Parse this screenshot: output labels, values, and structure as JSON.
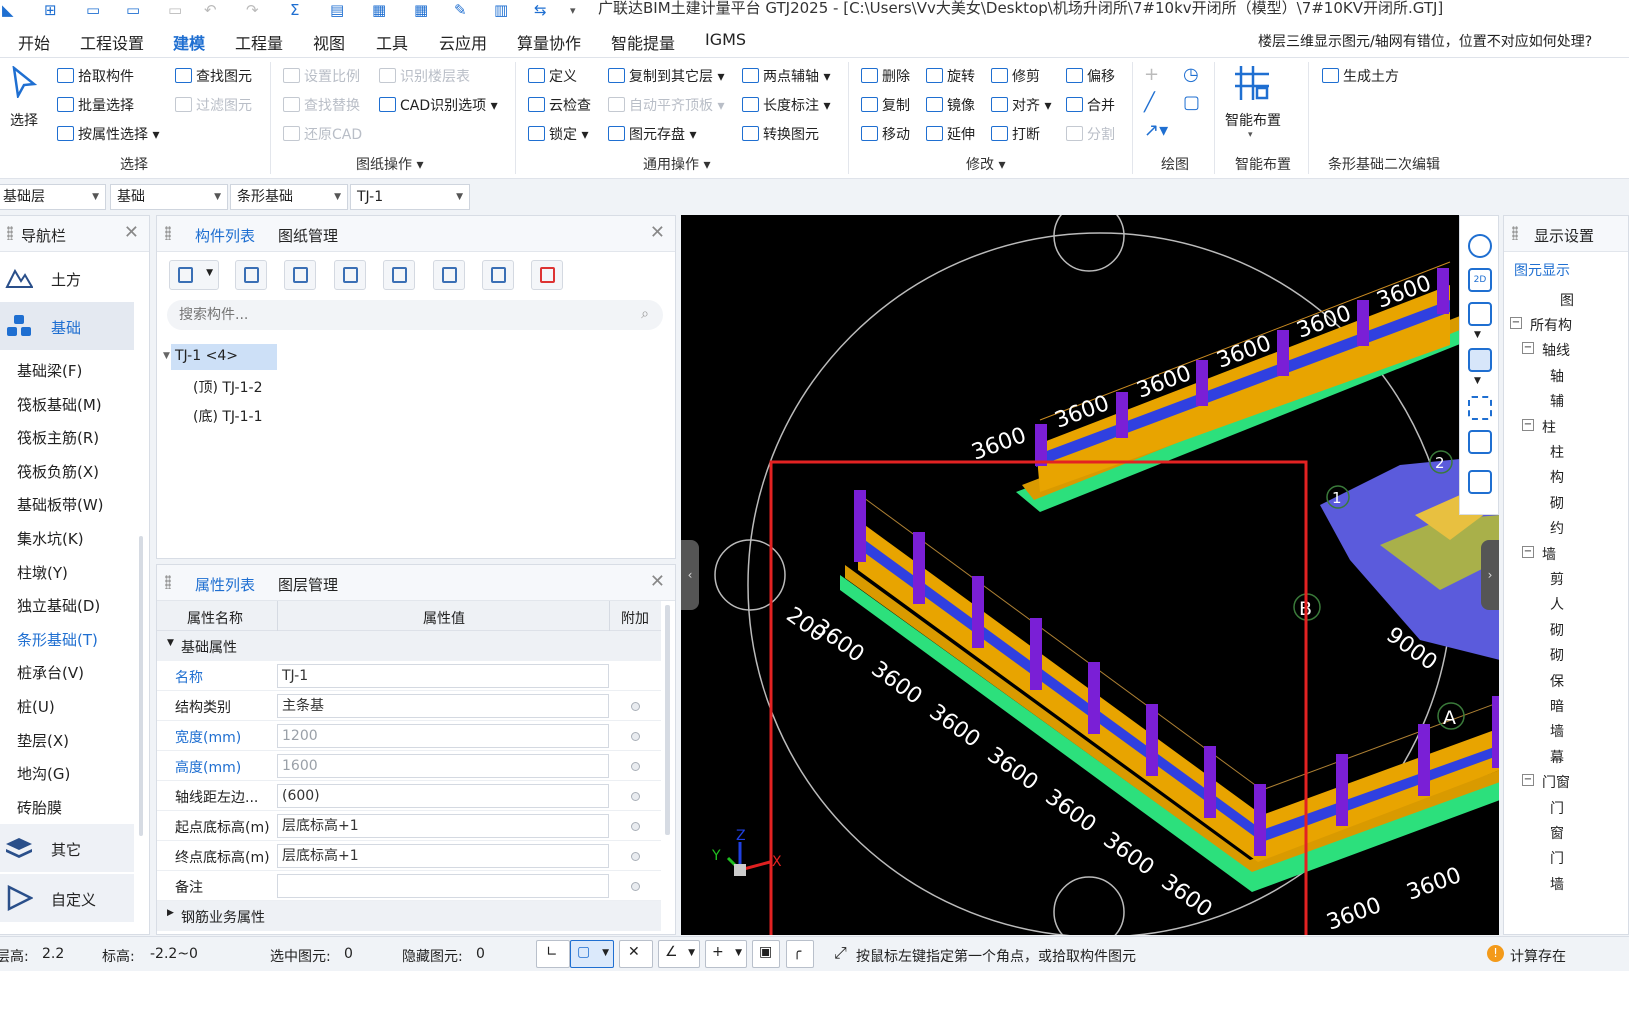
{
  "titlebar": {
    "title": "广联达BIM土建计量平台 GTJ2025 - [C:\\Users\\Vv大美女\\Desktop\\机场升闭所\\7#10kv开闭所（模型）\\7#10KV开闭所.GTJ]"
  },
  "menu": {
    "items": [
      "开始",
      "工程设置",
      "建模",
      "工程量",
      "视图",
      "工具",
      "云应用",
      "算量协作",
      "智能提量",
      "IGMS"
    ],
    "active": "建模",
    "help_question": "楼层三维显示图元/轴网有错位，位置不对应如何处理?"
  },
  "ribbon": {
    "select": {
      "label": "选择",
      "items": [
        "拾取构件",
        "批量选择",
        "按属性选择"
      ],
      "group": "选择"
    },
    "drawing_ops": {
      "items": [
        "查找图元",
        "过滤图元",
        "设置比例",
        "查找替换",
        "还原CAD",
        "识别楼层表",
        "CAD识别选项"
      ],
      "group": "图纸操作"
    },
    "common_ops": {
      "items": [
        "定义",
        "云检查",
        "锁定",
        "复制到其它层",
        "自动平齐顶板",
        "图元存盘",
        "两点辅轴",
        "长度标注",
        "转换图元"
      ],
      "group": "通用操作"
    },
    "modify": {
      "items": [
        "删除",
        "复制",
        "移动",
        "旋转",
        "镜像",
        "延伸",
        "修剪",
        "对齐",
        "打断",
        "偏移",
        "合并",
        "分割"
      ],
      "group": "修改"
    },
    "draw": {
      "group": "绘图"
    },
    "smart_layout": {
      "label": "智能布置",
      "group": "智能布置"
    },
    "strip_edit": {
      "items": [
        "生成土方"
      ],
      "group": "条形基础二次编辑"
    }
  },
  "selectors": {
    "floor": "基础层",
    "category": "基础",
    "type": "条形基础",
    "component": "TJ-1"
  },
  "nav": {
    "title": "导航栏",
    "groups": [
      {
        "label": "土方"
      },
      {
        "label": "基础"
      },
      {
        "label": "其它"
      },
      {
        "label": "自定义"
      }
    ],
    "items": [
      "基础梁(F)",
      "筏板基础(M)",
      "筏板主筋(R)",
      "筏板负筋(X)",
      "基础板带(W)",
      "集水坑(K)",
      "柱墩(Y)",
      "独立基础(D)",
      "条形基础(T)",
      "桩承台(V)",
      "桩(U)",
      "垫层(X)",
      "地沟(G)",
      "砖胎膜"
    ],
    "active_item": "条形基础(T)"
  },
  "component_list": {
    "tabs": [
      "构件列表",
      "图纸管理"
    ],
    "search_placeholder": "搜索构件...",
    "tree": {
      "root": "TJ-1 <4>",
      "children": [
        "(顶)  TJ-1-2",
        "(底)  TJ-1-1"
      ]
    }
  },
  "properties": {
    "tabs": [
      "属性列表",
      "图层管理"
    ],
    "headers": [
      "属性名称",
      "属性值",
      "附加"
    ],
    "section": "基础属性",
    "rows": [
      {
        "name": "名称",
        "value": "TJ-1"
      },
      {
        "name": "结构类别",
        "value": "主条基"
      },
      {
        "name": "宽度(mm)",
        "value": "1200"
      },
      {
        "name": "高度(mm)",
        "value": "1600"
      },
      {
        "name": "轴线距左边...",
        "value": "(600)"
      },
      {
        "name": "起点底标高(m)",
        "value": "层底标高+1"
      },
      {
        "name": "终点底标高(m)",
        "value": "层底标高+1"
      },
      {
        "name": "备注",
        "value": ""
      }
    ],
    "collapsed_section": "钢筋业务属性"
  },
  "viewport": {
    "dims_upper": [
      "3600",
      "3600",
      "3600",
      "3600",
      "3600",
      "3600"
    ],
    "dims_left": [
      "200",
      "3600",
      "3600",
      "3600",
      "3600",
      "3600",
      "3600",
      "3600"
    ],
    "dims_lower": [
      "3600",
      "3600"
    ],
    "dim_right": "9000",
    "axis_labels": [
      "B",
      "A",
      "1",
      "2"
    ],
    "axes": [
      "X",
      "Y",
      "Z"
    ],
    "vtools": [
      "2D"
    ]
  },
  "right_panel": {
    "title": "显示设置",
    "tab": "图元显示",
    "col": "图",
    "rows": [
      "所有构",
      "轴线",
      "轴",
      "辅",
      "柱",
      "柱",
      "构",
      "砌",
      "约",
      "墙",
      "剪",
      "人",
      "砌",
      "砌",
      "保",
      "暗",
      "墙",
      "幕",
      "门窗",
      "门",
      "窗",
      "门",
      "墙"
    ]
  },
  "status": {
    "floor_height_label": "层高:",
    "floor_height": "2.2",
    "elevation_label": "标高:",
    "elevation": "-2.2~0",
    "selected_label": "选中图元:",
    "selected": "0",
    "hidden_label": "隐藏图元:",
    "hidden": "0",
    "hint": "按鼠标左键指定第一个角点，或拾取构件图元",
    "calc": "计算存在"
  },
  "colors": {
    "accent": "#1f6fd1",
    "footing": "#e0a000",
    "wall_purple": "#7a1fd6",
    "pad_green": "#28e07a",
    "highlight_red": "#e32222"
  }
}
